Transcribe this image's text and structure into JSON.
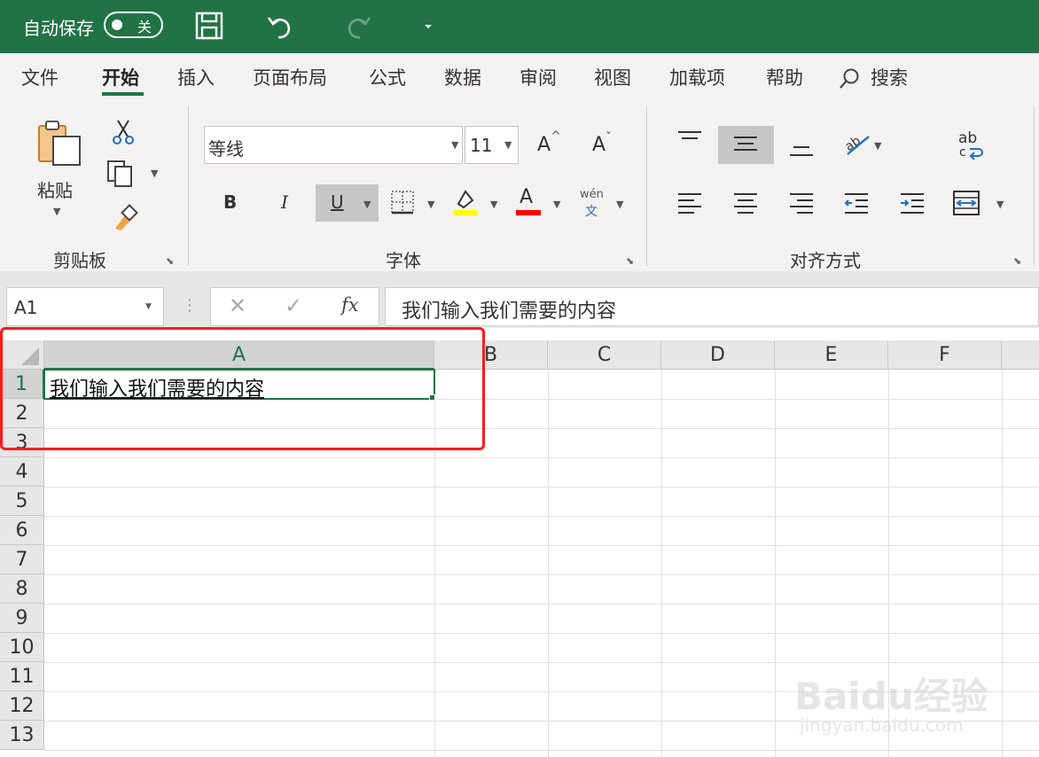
{
  "titlebar": {
    "autosave_label": "自动保存",
    "autosave_state": "关"
  },
  "tabs": [
    "文件",
    "开始",
    "插入",
    "页面布局",
    "公式",
    "数据",
    "审阅",
    "视图",
    "加载项",
    "帮助",
    "搜索"
  ],
  "active_tab": "开始",
  "ribbon": {
    "clipboard": {
      "paste_label": "粘贴",
      "group_label": "剪贴板"
    },
    "font": {
      "font_name": "等线",
      "font_size": "11",
      "group_label": "字体",
      "bold": "B",
      "italic": "I",
      "underline": "U",
      "font_color_glyph": "A",
      "grow_glyph": "A",
      "shrink_glyph": "A",
      "phonetic_top": "wén",
      "phonetic_bottom": "文"
    },
    "alignment": {
      "group_label": "对齐方式",
      "wrap_glyph": "ab"
    }
  },
  "formula_bar": {
    "name_box": "A1",
    "fx": "fx",
    "formula": "我们输入我们需要的内容"
  },
  "sheet": {
    "columns": [
      "A",
      "B",
      "C",
      "D",
      "E",
      "F"
    ],
    "rows": [
      "1",
      "2",
      "3",
      "4",
      "5",
      "6",
      "7",
      "8",
      "9",
      "10",
      "11",
      "12",
      "13"
    ],
    "a1_value": "我们输入我们需要的内容"
  },
  "watermark": {
    "line1": "Baidu经验",
    "line2": "jingyan.baidu.com"
  },
  "colors": {
    "accent": "#217346",
    "highlight_red": "#ff1a1a",
    "fill_yellow": "#ffff00",
    "font_red": "#ff0000"
  }
}
